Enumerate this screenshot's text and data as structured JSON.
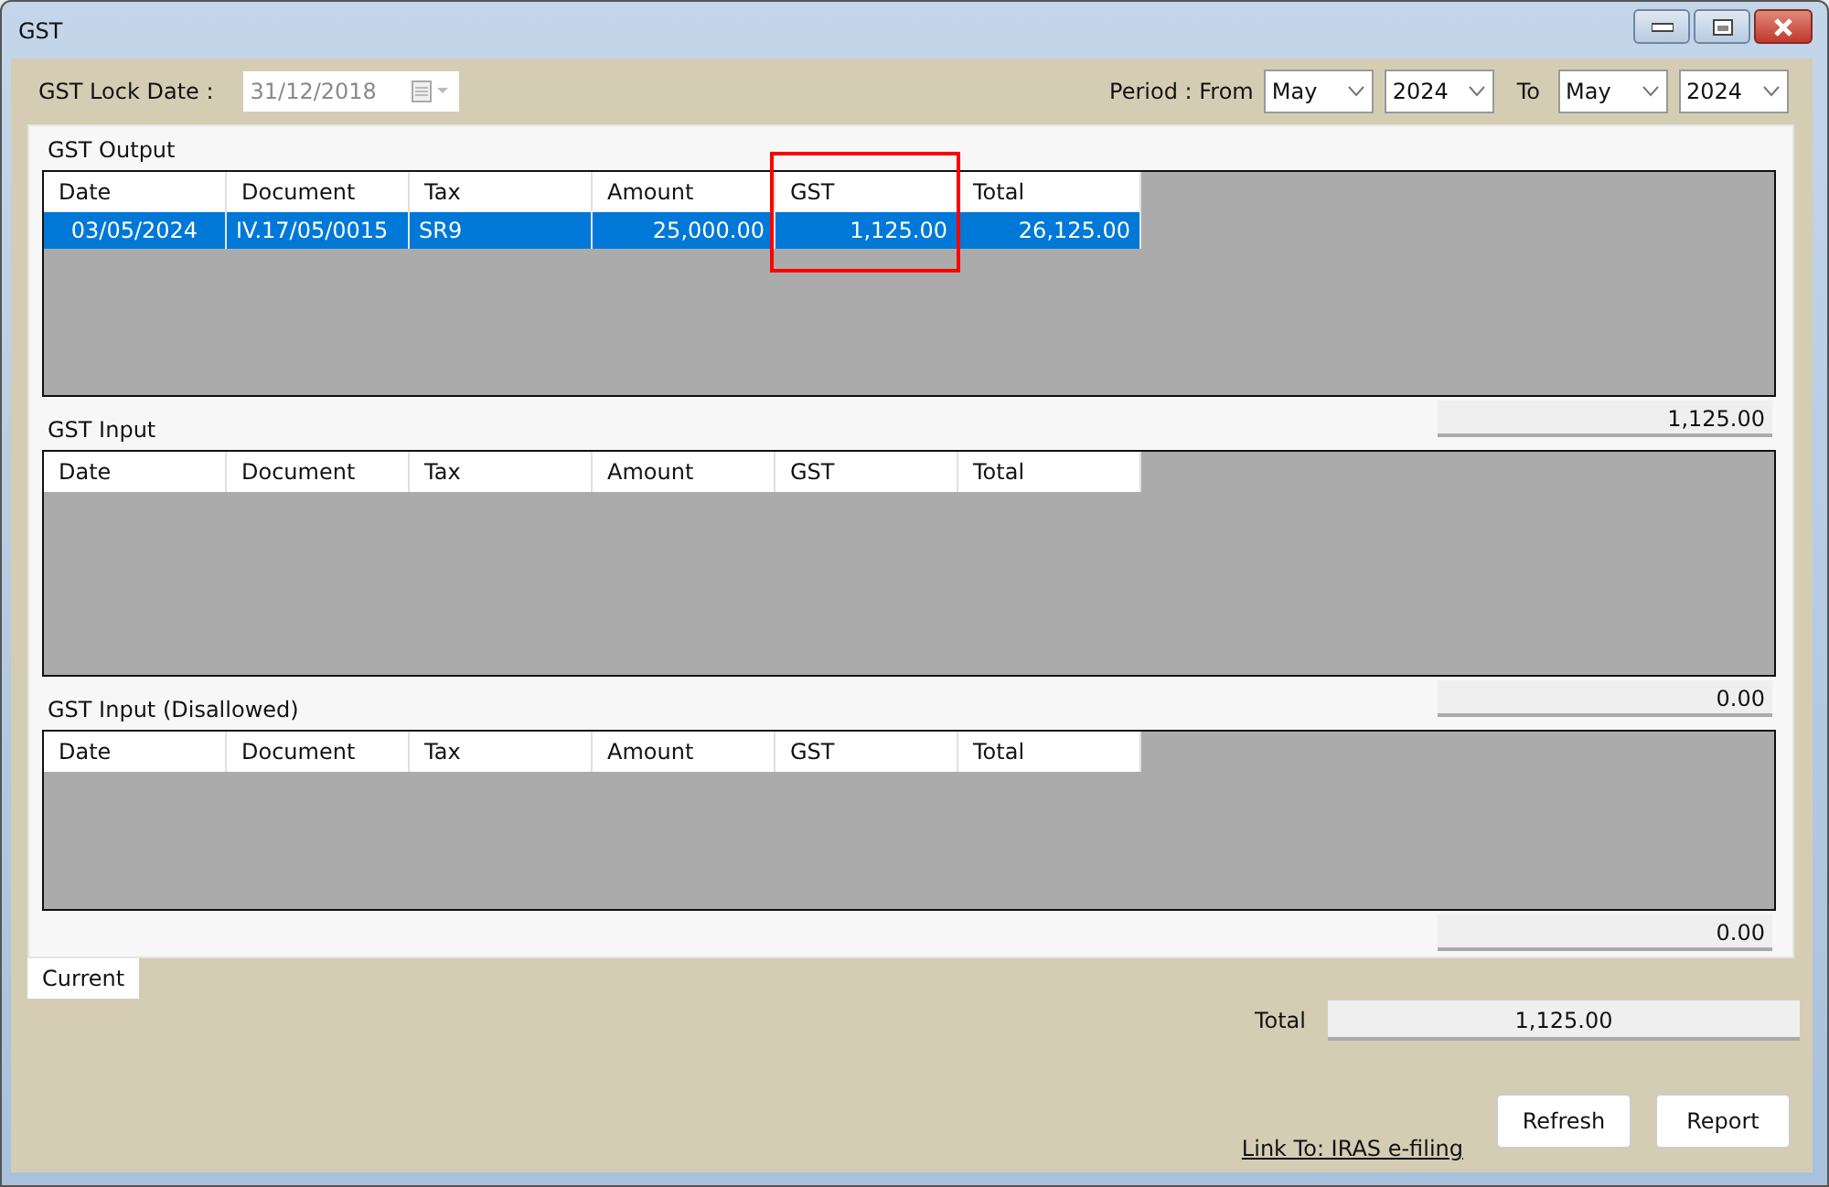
{
  "window": {
    "title": "GST"
  },
  "lock_date": {
    "label": "GST Lock Date :",
    "value": "31/12/2018",
    "disabled": true
  },
  "period": {
    "from_label": "Period : From",
    "from_month": "May",
    "from_year": "2024",
    "to_label": "To",
    "to_month": "May",
    "to_year": "2024"
  },
  "sections": [
    {
      "title": "GST Output",
      "columns": [
        {
          "label": "Date",
          "highlighted": false
        },
        {
          "label": "Document",
          "highlighted": false
        },
        {
          "label": "Tax",
          "highlighted": false
        },
        {
          "label": "Amount",
          "highlighted": false
        },
        {
          "label": "GST",
          "highlighted": true
        },
        {
          "label": "Total",
          "highlighted": false
        }
      ],
      "rows": [
        {
          "cells": [
            "03/05/2024",
            "IV.17/05/0015",
            "SR9",
            "25,000.00",
            "1,125.00",
            "26,125.00"
          ],
          "selected": true
        }
      ],
      "total": "1,125.00"
    },
    {
      "title": "GST Input",
      "columns": [
        {
          "label": "Date",
          "highlighted": false
        },
        {
          "label": "Document",
          "highlighted": false
        },
        {
          "label": "Tax",
          "highlighted": false
        },
        {
          "label": "Amount",
          "highlighted": false
        },
        {
          "label": "GST",
          "highlighted": false
        },
        {
          "label": "Total",
          "highlighted": false
        }
      ],
      "total": "0.00"
    },
    {
      "title": "GST Input (Disallowed)",
      "columns": [
        {
          "label": "Date",
          "highlighted": false
        },
        {
          "label": "Document",
          "highlighted": false
        },
        {
          "label": "Tax",
          "highlighted": false
        },
        {
          "label": "Amount",
          "highlighted": false
        },
        {
          "label": "GST",
          "highlighted": false
        },
        {
          "label": "Total",
          "highlighted": false
        }
      ],
      "total": "0.00"
    }
  ],
  "tabs": [
    {
      "label": "Current",
      "selected": true
    }
  ],
  "total": {
    "label": "Total",
    "value": "1,125.00"
  },
  "link": "Link To: IRAS e-filing",
  "buttons": [
    "Refresh",
    "Report"
  ]
}
